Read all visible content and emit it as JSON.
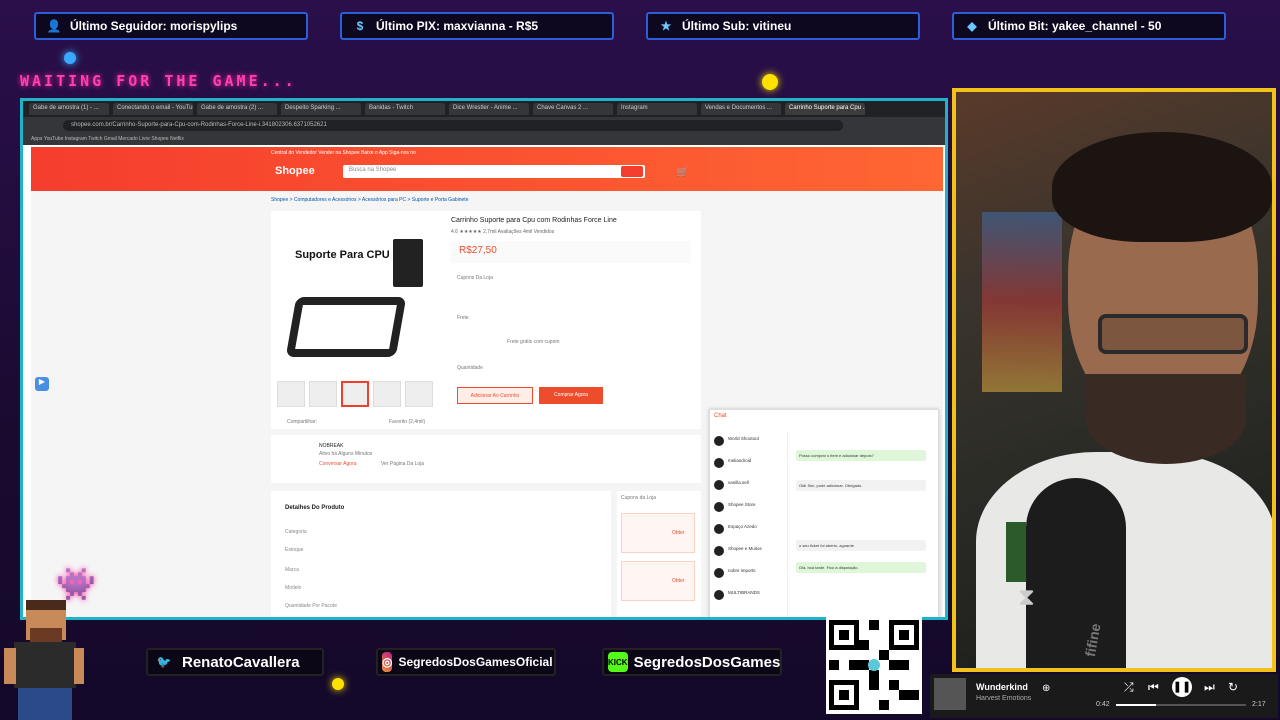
{
  "overlay": {
    "last_follower": "Último Seguidor: morispylips",
    "last_pix": "Último PIX: maxvianna - R$5",
    "last_sub": "Último Sub: vitineu",
    "last_bit": "Último Bit: yakee_channel - 50",
    "waiting": "WAITING FOR THE GAME...",
    "accent_pink": "#ff3fb0",
    "accent_cyan": "#1fb3c9",
    "accent_yellow": "#f2c21b"
  },
  "browser": {
    "tabs": [
      "Gabe de amostra (1) - ...",
      "Conectando o email - YouTube",
      "Gabe de amostra (2) ...",
      "Despeito Sparking ...",
      "Banidas - Twitch",
      "Dice Wrestler - Anime ...",
      "Chave Canvas 2 ...",
      "Instagram",
      "Vendas e Documentos ...",
      "Carrinho Suporte para Cpu ..."
    ],
    "url": "shopee.com.br/Carrinho-Suporte-para-Cpu-com-Rodinhas-Force-Line-i.341802306.6371052621",
    "bookmarks": "Apps  YouTube  Instagram  Twitch  Gmail  Mercado Livre  Shopee  Netflix"
  },
  "shopee": {
    "top_links": "Central do Vendedor  Vender na Shopee  Baixe o App  Siga-nos no",
    "logo": "Shopee",
    "search_placeholder": "Busca na Shopee",
    "breadcrumb": "Shopee > Computadores e Acessórios > Acessórios para PC > Suporte e Porta Gabinete",
    "product_title": "Carrinho Suporte para Cpu com Rodinhas Force Line",
    "rating": "4.6 ★★★★★  2,7mil Avaliações  4mil Vendidos",
    "price": "R$27,50",
    "image_caption": "Suporte Para CPU",
    "coupon_label": "Cupons Da Loja",
    "shipping_label": "Frete",
    "shipping_value": "Frete grátis com cupom",
    "quantity_label": "Quantidade",
    "add_to_cart": "Adicionar Ao Carrinho",
    "buy_now": "Comprar Agora",
    "share_label": "Compartilhar:",
    "favorite_label": "Favorito (2,4mil)",
    "shop_name": "NOBREAK",
    "shop_status": "Ativo há Alguns Minutos",
    "chat_now": "Conversar Agora",
    "view_shop": "Ver Página Da Loja",
    "details_title": "Detalhes Do Produto",
    "detail_rows": [
      "Categoria",
      "Estoque",
      "Marca",
      "Modelo",
      "Quantidade Por Pacote"
    ],
    "coupons_title": "Cupons da Loja",
    "coupon_buttons": [
      "Obter",
      "Obter"
    ]
  },
  "chat": {
    "title": "Chat",
    "contacts": [
      "World Shootout",
      "meliandroid",
      "vanilla.sell",
      "Shopee Store",
      "Espaço Azedo",
      "Shopee e Muitos",
      "nobre imports",
      "MULTIBRANDS"
    ],
    "messages": [
      "Posso comprar o item e adicionar depois?",
      "Olá! Sim, pode adicionar. Obrigado.",
      "o seu ticket foi aberto, aguarde",
      "Olá, boa tarde. Fico à disposição."
    ]
  },
  "social": {
    "twitter": "RenatoCavallera",
    "instagram": "SegredosDosGamesOficial",
    "kick": "SegredosDosGames",
    "kick_badge": "KICK"
  },
  "qr": {
    "url": "livepix.gg/segredosdosgames"
  },
  "player": {
    "title": "Wunderkind",
    "artist": "Harvest Emotions",
    "elapsed": "0:42",
    "duration": "2:17",
    "progress": 0.31
  },
  "mic_brand": "fifine"
}
